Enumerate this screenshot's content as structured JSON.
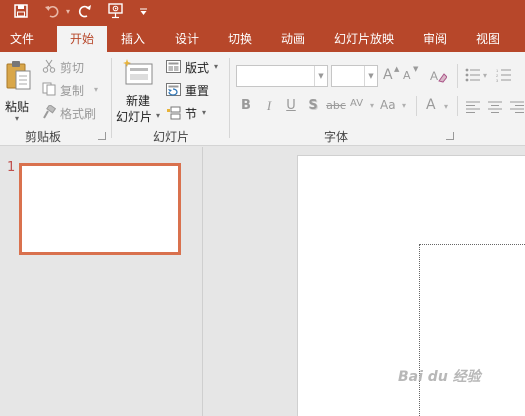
{
  "quick_access": {
    "icons": [
      "save-icon",
      "undo-icon",
      "redo-icon",
      "start-from-beginning-icon",
      "customize-quick-access-icon"
    ]
  },
  "tabs": [
    {
      "label": "文件",
      "active": false
    },
    {
      "label": "开始",
      "active": true
    },
    {
      "label": "插入",
      "active": false
    },
    {
      "label": "设计",
      "active": false
    },
    {
      "label": "切换",
      "active": false
    },
    {
      "label": "动画",
      "active": false
    },
    {
      "label": "幻灯片放映",
      "active": false
    },
    {
      "label": "审阅",
      "active": false
    },
    {
      "label": "视图",
      "active": false
    }
  ],
  "clipboard": {
    "paste": "粘贴",
    "cut": "剪切",
    "copy": "复制",
    "format_painter": "格式刷",
    "group_label": "剪贴板"
  },
  "slides_group": {
    "new_slide_line1": "新建",
    "new_slide_line2": "幻灯片",
    "layout": "版式",
    "reset": "重置",
    "section": "节",
    "group_label": "幻灯片"
  },
  "font_group": {
    "font_name": "",
    "font_size": "",
    "increase_size": "A",
    "decrease_size": "A",
    "bold": "B",
    "italic": "I",
    "underline": "U",
    "shadow": "S",
    "strikethrough": "abc",
    "spacing": "AV",
    "change_case": "Aa",
    "font_color": "A",
    "group_label": "字体"
  },
  "thumbnails": {
    "slide_number": "1"
  },
  "watermark": "Bai du 经验",
  "colors": {
    "accent": "#b7472a",
    "thumbnail_border": "#d9714e",
    "ribbon_bg": "#f3f3f3",
    "workspace_bg": "#e6e6e6"
  }
}
